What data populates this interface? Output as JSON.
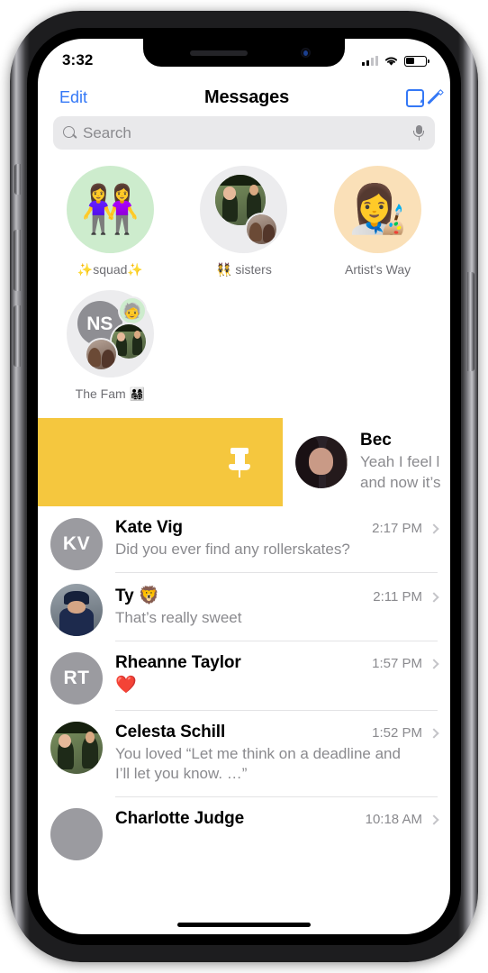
{
  "status_bar": {
    "time": "3:32",
    "signal_icon": "cellular-signal-icon",
    "wifi_icon": "wifi-icon",
    "battery_icon": "battery-icon",
    "battery_level_pct": 42
  },
  "nav_bar": {
    "edit_label": "Edit",
    "title": "Messages",
    "compose_icon": "compose-icon",
    "accent_color": "#3478f6"
  },
  "search": {
    "placeholder": "Search",
    "value": "",
    "search_icon": "search-icon",
    "mic_icon": "microphone-icon"
  },
  "pinned": [
    {
      "label": "✨squad✨",
      "avatar_type": "emoji",
      "emoji": "👭",
      "bg_color": "#cdeccd"
    },
    {
      "label": "👯 sisters",
      "avatar_type": "cluster",
      "bg_color": "#ececee"
    },
    {
      "label": "Artist’s Way",
      "avatar_type": "emoji",
      "emoji": "👩‍🎨",
      "bg_color": "#fae0b8"
    },
    {
      "label": "The Fam 👨‍👩‍👧‍👦",
      "avatar_type": "cluster-initials",
      "initials": "NS",
      "bg_color": "#ececee"
    }
  ],
  "swipe_row": {
    "action_label": "Pin",
    "action_icon": "pin-icon",
    "action_bg_color": "#f5c73e",
    "name": "Bec",
    "preview_line_1": "Yeah I feel l",
    "preview_line_2": "and now it’s"
  },
  "conversations": [
    {
      "name": "Kate Vig",
      "time": "2:17 PM",
      "preview": "Did you ever find any rollerskates?",
      "avatar_type": "initials",
      "initials": "KV",
      "emoji_only": false
    },
    {
      "name": "Ty 🦁",
      "time": "2:11 PM",
      "preview": "That’s really sweet",
      "avatar_type": "photo-cap",
      "initials": "",
      "emoji_only": false
    },
    {
      "name": "Rheanne Taylor",
      "time": "1:57 PM",
      "preview": "❤️",
      "avatar_type": "initials",
      "initials": "RT",
      "emoji_only": true
    },
    {
      "name": "Celesta Schill",
      "time": "1:52 PM",
      "preview": "You loved “Let me think on a deadline and I’ll let you know. …”",
      "avatar_type": "photo-green",
      "initials": "",
      "emoji_only": false
    },
    {
      "name": "Charlotte Judge",
      "time": "10:18 AM",
      "preview": "",
      "avatar_type": "initials",
      "initials": "",
      "emoji_only": false
    }
  ]
}
